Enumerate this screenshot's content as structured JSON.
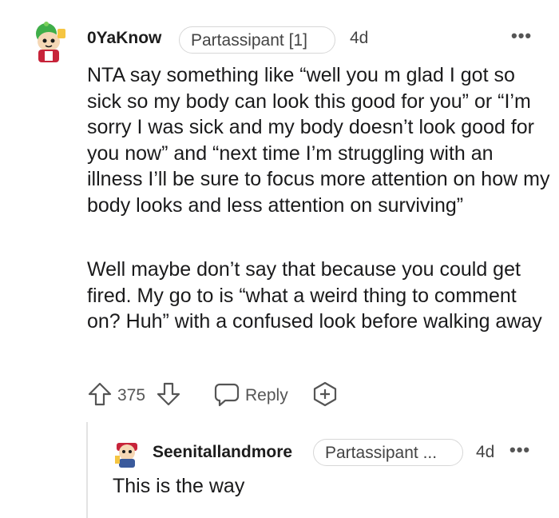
{
  "comment": {
    "username": "0YaKnow",
    "flair": "Partassipant [1]",
    "time": "4d",
    "more": "•••",
    "paragraphs": [
      "NTA say something like “well you m glad I got so sick so my body can look this good for you” or “I’m sorry I was sick and my body doesn’t look good for you now” and “next time I’m struggling with an illness I’ll be sure to focus more attention on how my body looks and less attention on surviving”",
      "Well maybe don’t say that because you could get fired. My go to is “what a weird thing to comment on? Huh” with a confused look before walking away"
    ],
    "score": "375",
    "reply_label": "Reply"
  },
  "reply": {
    "username": "Seenitallandmore",
    "flair": "Partassipant ...",
    "time": "4d",
    "more": "•••",
    "body": "This is the way"
  },
  "icons": {
    "upvote": "upvote-arrow-icon",
    "downvote": "downvote-arrow-icon",
    "reply": "speech-bubble-icon",
    "award": "award-plus-icon"
  },
  "colors": {
    "text": "#1a1a1b",
    "muted": "#555555",
    "flair_border": "#d7d7d7",
    "thread_line": "#e3e3e3"
  }
}
